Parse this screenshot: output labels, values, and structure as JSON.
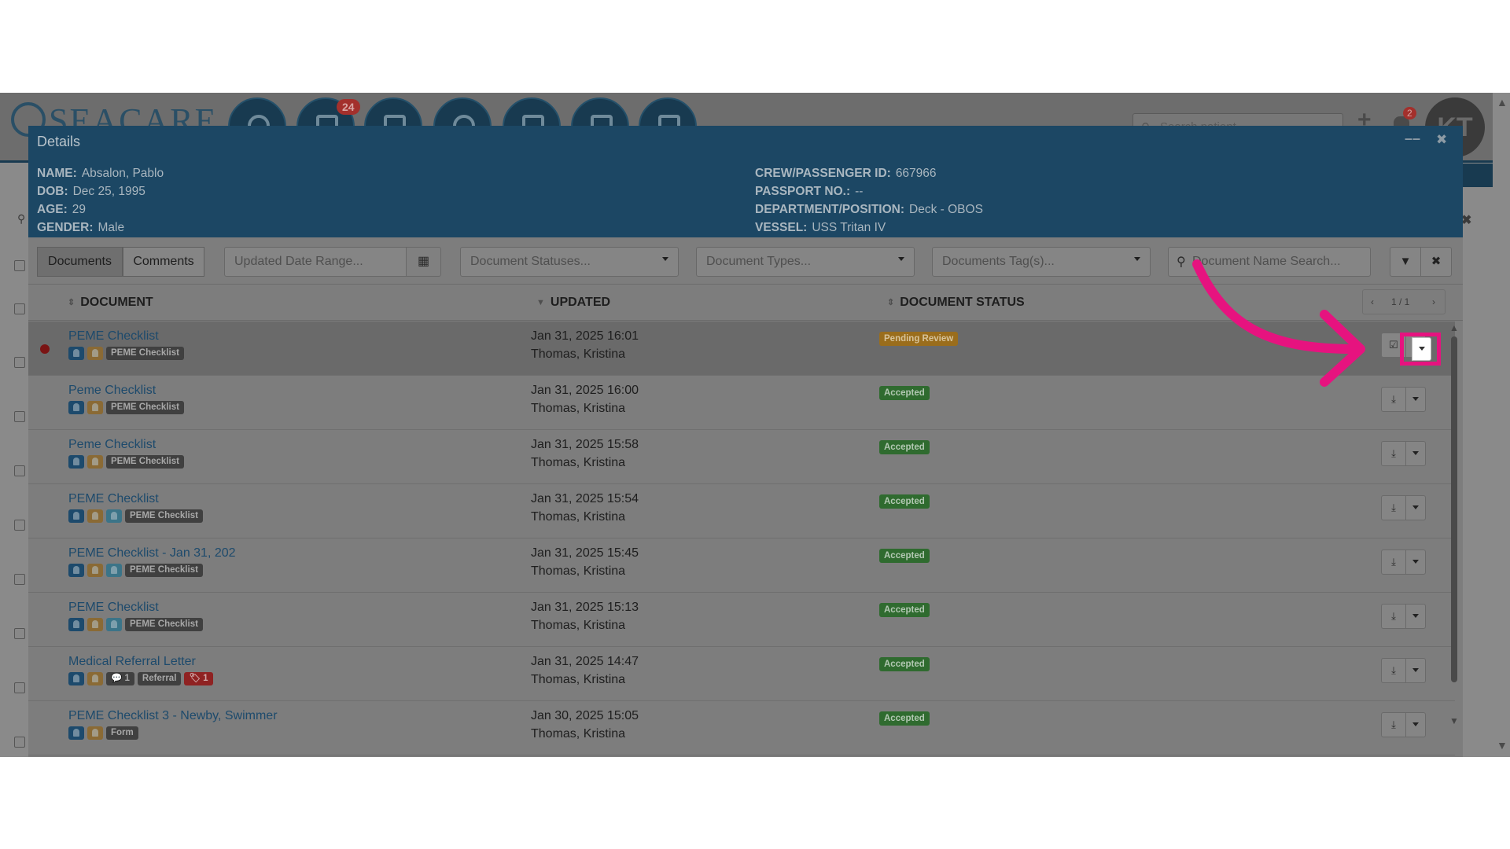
{
  "app": {
    "logo_text": "SEACARE",
    "nav_badge_count": "24",
    "search_placeholder": "Search patient",
    "bell_count": "2",
    "avatar_initials": "KT"
  },
  "modal": {
    "title": "Details",
    "info_left": [
      {
        "label": "NAME:",
        "value": "Absalon, Pablo"
      },
      {
        "label": "DOB:",
        "value": "Dec 25, 1995"
      },
      {
        "label": "AGE:",
        "value": "29"
      },
      {
        "label": "GENDER:",
        "value": "Male"
      }
    ],
    "info_right": [
      {
        "label": "CREW/PASSENGER ID:",
        "value": "667966"
      },
      {
        "label": "PASSPORT NO.:",
        "value": "--"
      },
      {
        "label": "DEPARTMENT/POSITION:",
        "value": "Deck - OBOS"
      },
      {
        "label": "VESSEL:",
        "value": "USS Tritan IV"
      }
    ]
  },
  "toolbar": {
    "tab_documents": "Documents",
    "tab_comments": "Comments",
    "date_range_placeholder": "Updated Date Range...",
    "statuses_placeholder": "Document Statuses...",
    "types_placeholder": "Document Types...",
    "tags_placeholder": "Documents Tag(s)...",
    "name_search_placeholder": "Document Name Search..."
  },
  "table": {
    "col_document": "DOCUMENT",
    "col_updated": "UPDATED",
    "col_status": "DOCUMENT STATUS",
    "pager": "1 / 1",
    "rows": [
      {
        "title": "PEME Checklist",
        "tags": [
          "blue",
          "orange"
        ],
        "labels": [
          "PEME Checklist"
        ],
        "updated": "Jan 31, 2025 16:01",
        "by": "Thomas, Kristina",
        "status": "Pending Review",
        "status_kind": "pending",
        "unread": true,
        "action_icon": "check-square-icon"
      },
      {
        "title": "Peme Checklist",
        "tags": [
          "blue",
          "orange"
        ],
        "labels": [
          "PEME Checklist"
        ],
        "updated": "Jan 31, 2025 16:00",
        "by": "Thomas, Kristina",
        "status": "Accepted",
        "status_kind": "accepted",
        "unread": false,
        "action_icon": "download-icon"
      },
      {
        "title": "Peme Checklist",
        "tags": [
          "blue",
          "orange"
        ],
        "labels": [
          "PEME Checklist"
        ],
        "updated": "Jan 31, 2025 15:58",
        "by": "Thomas, Kristina",
        "status": "Accepted",
        "status_kind": "accepted",
        "unread": false,
        "action_icon": "download-icon"
      },
      {
        "title": "PEME Checklist",
        "tags": [
          "blue",
          "orange",
          "teal"
        ],
        "labels": [
          "PEME Checklist"
        ],
        "updated": "Jan 31, 2025 15:54",
        "by": "Thomas, Kristina",
        "status": "Accepted",
        "status_kind": "accepted",
        "unread": false,
        "action_icon": "download-icon"
      },
      {
        "title": "PEME Checklist - Jan 31, 202",
        "tags": [
          "blue",
          "orange",
          "teal"
        ],
        "labels": [
          "PEME Checklist"
        ],
        "updated": "Jan 31, 2025 15:45",
        "by": "Thomas, Kristina",
        "status": "Accepted",
        "status_kind": "accepted",
        "unread": false,
        "action_icon": "download-icon"
      },
      {
        "title": "PEME Checklist",
        "tags": [
          "blue",
          "orange",
          "teal"
        ],
        "labels": [
          "PEME Checklist"
        ],
        "updated": "Jan 31, 2025 15:13",
        "by": "Thomas, Kristina",
        "status": "Accepted",
        "status_kind": "accepted",
        "unread": false,
        "action_icon": "download-icon"
      },
      {
        "title": "Medical Referral Letter",
        "tags": [
          "blue",
          "orange"
        ],
        "labels": [
          "💬 1",
          "Referral"
        ],
        "red_label": "🏷 1",
        "updated": "Jan 31, 2025 14:47",
        "by": "Thomas, Kristina",
        "status": "Accepted",
        "status_kind": "accepted",
        "unread": false,
        "action_icon": "download-icon"
      },
      {
        "title": "PEME Checklist 3 - Newby, Swimmer",
        "tags": [
          "blue",
          "orange"
        ],
        "labels": [
          "Form"
        ],
        "updated": "Jan 30, 2025 15:05",
        "by": "Thomas, Kristina",
        "status": "Accepted",
        "status_kind": "accepted",
        "unread": false,
        "action_icon": "download-icon"
      }
    ]
  },
  "annotation": {
    "color": "#e6137f"
  }
}
